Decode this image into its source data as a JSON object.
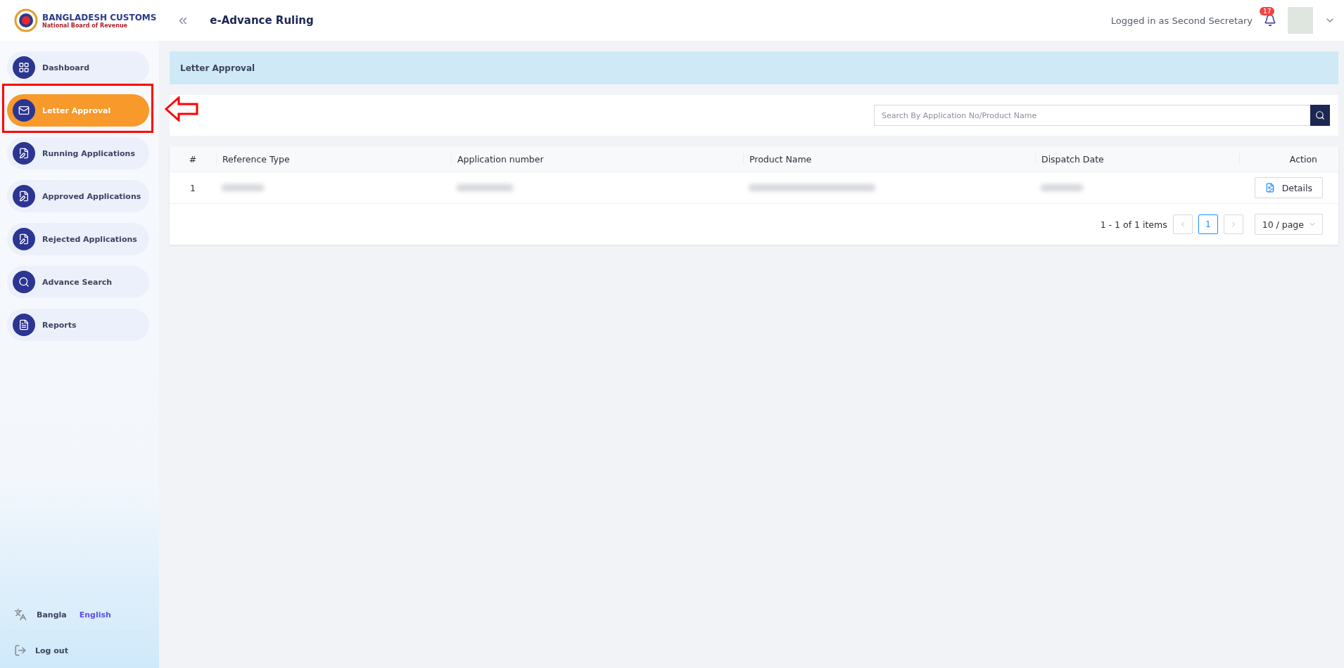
{
  "brand": {
    "title": "BANGLADESH CUSTOMS",
    "subtitle": "National Board of Revenue"
  },
  "header": {
    "collapse_icon": "«",
    "app_title": "e-Advance Ruling",
    "logged_in": "Logged in as Second Secretary",
    "notifications": "17"
  },
  "sidebar": {
    "items": [
      {
        "label": "Dashboard",
        "selected": false
      },
      {
        "label": "Letter Approval",
        "selected": true
      },
      {
        "label": "Running Applications",
        "selected": false
      },
      {
        "label": "Approved Applications",
        "selected": false
      },
      {
        "label": "Rejected Applications",
        "selected": false
      },
      {
        "label": "Advance Search",
        "selected": false
      },
      {
        "label": "Reports",
        "selected": false
      }
    ],
    "languages": [
      {
        "label": "Bangla",
        "selected": false
      },
      {
        "label": "English",
        "selected": true
      }
    ],
    "logout": "Log out"
  },
  "page_title": "Letter Approval",
  "search": {
    "placeholder": "Search By Application No/Product Name"
  },
  "table": {
    "columns": [
      "#",
      "Reference Type",
      "Application number",
      "Product Name",
      "Dispatch Date",
      "Action"
    ],
    "rows": [
      {
        "index": "1",
        "action": "Details"
      }
    ]
  },
  "pagination": {
    "summary": "1 - 1 of 1 items",
    "pages": [
      {
        "label": "1",
        "selected": true
      }
    ],
    "page_size": "10 / page"
  }
}
